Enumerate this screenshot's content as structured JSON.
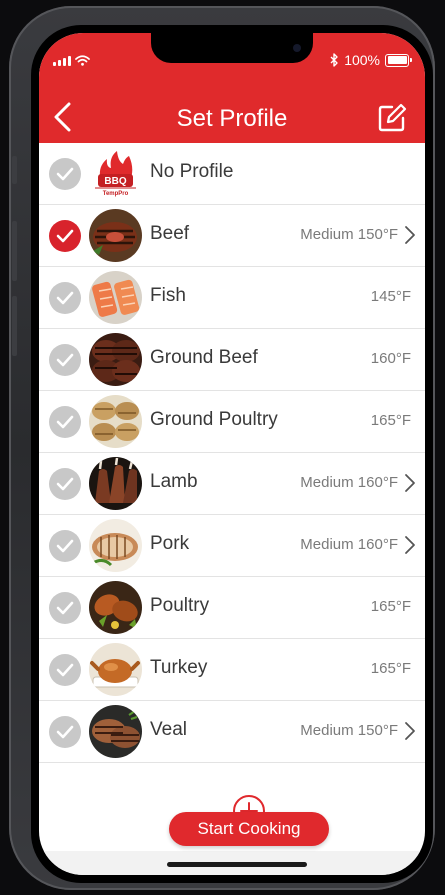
{
  "status_bar": {
    "battery_text": "100%",
    "icons": [
      "signal-icon",
      "wifi-icon",
      "bluetooth-icon",
      "battery-icon"
    ]
  },
  "header": {
    "title": "Set Profile",
    "back_icon": "chevron-left-icon",
    "edit_icon": "edit-icon",
    "background": "#e02a2c"
  },
  "profiles": [
    {
      "name": "No Profile",
      "temp": "",
      "selected": false,
      "has_chevron": false,
      "image": "bbq-logo",
      "logo_text": "BBQ",
      "logo_subtext": "TempPro"
    },
    {
      "name": "Beef",
      "temp": "Medium 150°F",
      "selected": true,
      "has_chevron": true,
      "image": "beef"
    },
    {
      "name": "Fish",
      "temp": "145°F",
      "selected": false,
      "has_chevron": false,
      "image": "fish"
    },
    {
      "name": "Ground Beef",
      "temp": "160°F",
      "selected": false,
      "has_chevron": false,
      "image": "ground-beef"
    },
    {
      "name": "Ground Poultry",
      "temp": "165°F",
      "selected": false,
      "has_chevron": false,
      "image": "ground-poultry"
    },
    {
      "name": "Lamb",
      "temp": "Medium 160°F",
      "selected": false,
      "has_chevron": true,
      "image": "lamb"
    },
    {
      "name": "Pork",
      "temp": "Medium 160°F",
      "selected": false,
      "has_chevron": true,
      "image": "pork"
    },
    {
      "name": "Poultry",
      "temp": "165°F",
      "selected": false,
      "has_chevron": false,
      "image": "poultry"
    },
    {
      "name": "Turkey",
      "temp": "165°F",
      "selected": false,
      "has_chevron": false,
      "image": "turkey"
    },
    {
      "name": "Veal",
      "temp": "Medium 150°F",
      "selected": false,
      "has_chevron": true,
      "image": "veal"
    }
  ],
  "footer": {
    "add_icon": "plus-circle-icon",
    "start_label": "Start Cooking"
  },
  "colors": {
    "accent": "#e02a2c",
    "selected_check": "#d8232c",
    "unselected_check": "#c8c8c8"
  }
}
